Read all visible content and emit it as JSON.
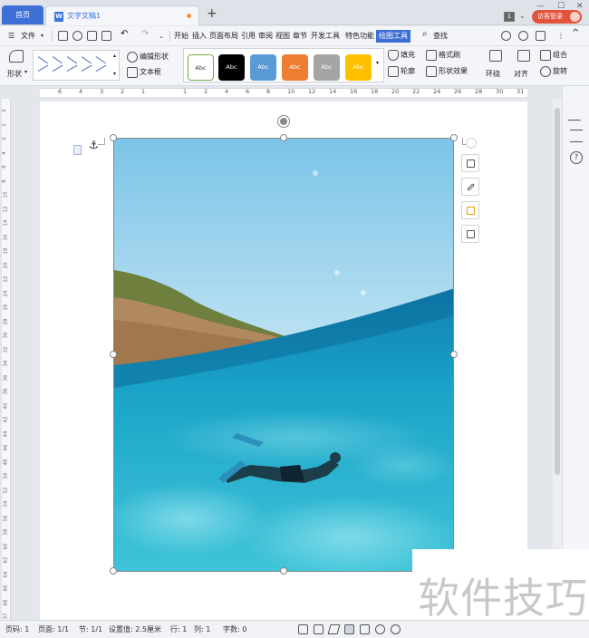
{
  "titlebar": {
    "home_tab": "首页",
    "doc_tab": "文字文稿1",
    "add_tab": "+",
    "page_badge": "1",
    "visitor_login": "访客登录"
  },
  "menubar": {
    "file": "文件",
    "items": [
      "开始",
      "插入",
      "页面布局",
      "引用",
      "审阅",
      "视图",
      "章节",
      "开发工具",
      "特色功能",
      "绘图工具"
    ],
    "active": "绘图工具",
    "search": "查找"
  },
  "ribbon": {
    "shape_label": "形状",
    "edit_shape": "编辑形状",
    "textbox": "文本框",
    "style_sample": "Abc",
    "fill": "填充",
    "format_brush": "格式刷",
    "outline": "轮廓",
    "shape_effect": "形状效果",
    "wrap": "环绕",
    "align": "对齐",
    "group": "组合",
    "rotate": "旋转"
  },
  "ruler": {
    "horizontal": [
      "6",
      "4",
      "3",
      "2",
      "1",
      "",
      "1",
      "2",
      "4",
      "6",
      "8",
      "10",
      "12",
      "14",
      "16",
      "18",
      "20",
      "22",
      "24",
      "26",
      "28",
      "30",
      "31"
    ],
    "vertical": [
      "2",
      "1",
      "2",
      "4",
      "6",
      "8",
      "10",
      "12",
      "14",
      "16",
      "18",
      "20",
      "22",
      "24",
      "26",
      "28",
      "30",
      "32",
      "34",
      "36",
      "38",
      "40",
      "42",
      "44",
      "46",
      "48",
      "50",
      "52",
      "54",
      "56",
      "58",
      "60",
      "62",
      "64",
      "66",
      "68",
      "37"
    ]
  },
  "statusbar": {
    "page_num": "页码: 1",
    "pages": "页面: 1/1",
    "section": "节: 1/1",
    "setting": "设置值: 2.5厘米",
    "row": "行: 1",
    "col": "列: 1",
    "words": "字数: 0"
  },
  "watermark": "软件技巧",
  "colors": {
    "accent": "#3d6fd6",
    "visitor": "#e2533b",
    "style_colors": [
      "#ffffff",
      "#000000",
      "#5b9bd5",
      "#ed7d31",
      "#a5a5a5",
      "#ffc000"
    ]
  }
}
